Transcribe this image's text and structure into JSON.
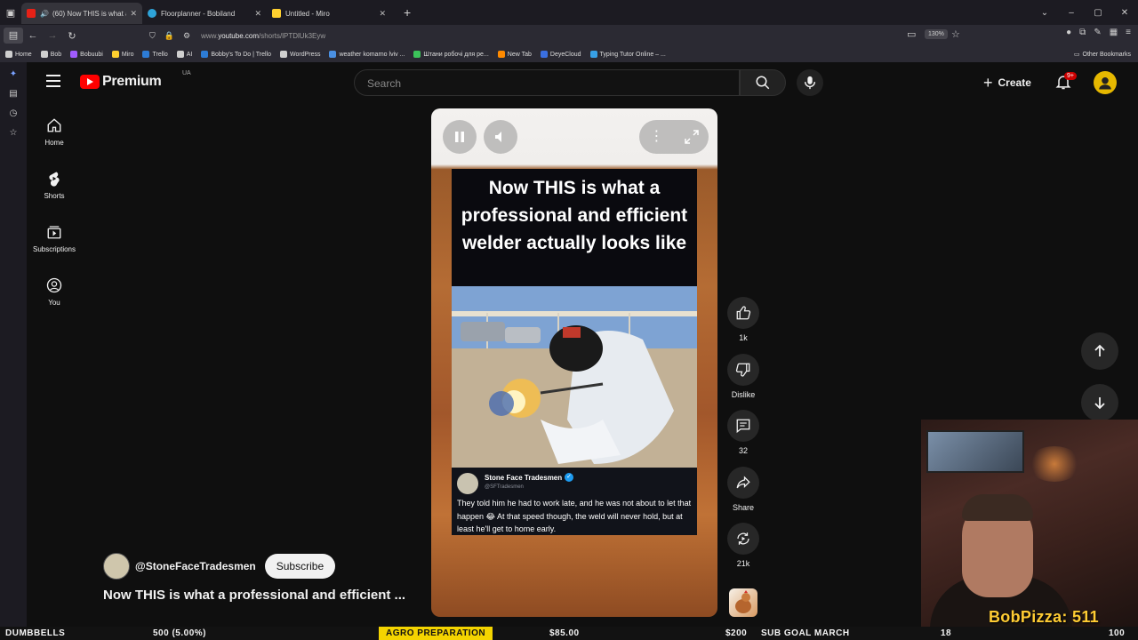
{
  "browser": {
    "tabs": [
      {
        "title": "(60) Now THIS is what a pr",
        "active": true
      },
      {
        "title": "Floorplanner - Bobiland",
        "active": false
      },
      {
        "title": "Untitled - Miro",
        "active": false
      }
    ],
    "url_prefix": "www.",
    "url_host": "youtube.com",
    "url_path": "/shorts/lPTDlUk3Eyw",
    "zoom": "130%",
    "bookmarks": [
      {
        "label": "Home",
        "color": "#cfcfcf"
      },
      {
        "label": "Bob",
        "color": "#cfcfcf"
      },
      {
        "label": "Bobuubi",
        "color": "#a15cff"
      },
      {
        "label": "Miro",
        "color": "#ffd02f"
      },
      {
        "label": "Trello",
        "color": "#2d7cd6"
      },
      {
        "label": "AI",
        "color": "#cfcfcf"
      },
      {
        "label": "Bobby's To Do | Trello",
        "color": "#2d7cd6"
      },
      {
        "label": "WordPress",
        "color": "#cfcfcf"
      },
      {
        "label": "weather komarno lviv ...",
        "color": "#4a90e2"
      },
      {
        "label": "Штани робочі для ре...",
        "color": "#3cc35a"
      },
      {
        "label": "New Tab",
        "color": "#ff8a00"
      },
      {
        "label": "DeyeCloud",
        "color": "#3a6fe0"
      },
      {
        "label": "Typing Tutor Online – ...",
        "color": "#37a0e6"
      }
    ],
    "other_bookmarks": "Other Bookmarks"
  },
  "header": {
    "logo": "Premium",
    "region": "UA",
    "search_placeholder": "Search",
    "create_label": "Create",
    "notif_badge": "9+"
  },
  "nav": {
    "items": [
      {
        "label": "Home"
      },
      {
        "label": "Shorts"
      },
      {
        "label": "Subscriptions"
      },
      {
        "label": "You"
      }
    ]
  },
  "short": {
    "headline": "Now THIS is what a professional and efficient welder actually looks like",
    "tweet_name": "Stone Face Tradesmen",
    "tweet_handle": "@SFTradesmen",
    "tweet_text": "They told him he had to work late, and he was not about to let that happen 😂 At that speed though, the weld will never hold, but at least he'll get to home early.",
    "channel": "@StoneFaceTradesmen",
    "subscribe": "Subscribe",
    "title": "Now THIS is what a professional and efficient ..."
  },
  "actions": {
    "likes": "1k",
    "dislike": "Dislike",
    "comments": "32",
    "share": "Share",
    "remix": "21k"
  },
  "stream": {
    "overlay_text": "BobPizza: 511",
    "ticker": [
      "DUMBBELLS",
      "500 (5.00%)",
      "AGRO PREPARATION",
      "$85.00",
      "$200",
      "SUB GOAL MARCH",
      "18",
      "100"
    ]
  },
  "colors": {
    "yt_red": "#ff0000",
    "badge_red": "#cc0000",
    "overlay_yellow": "#ffcc33",
    "ticker_highlight": "#f4d400"
  }
}
